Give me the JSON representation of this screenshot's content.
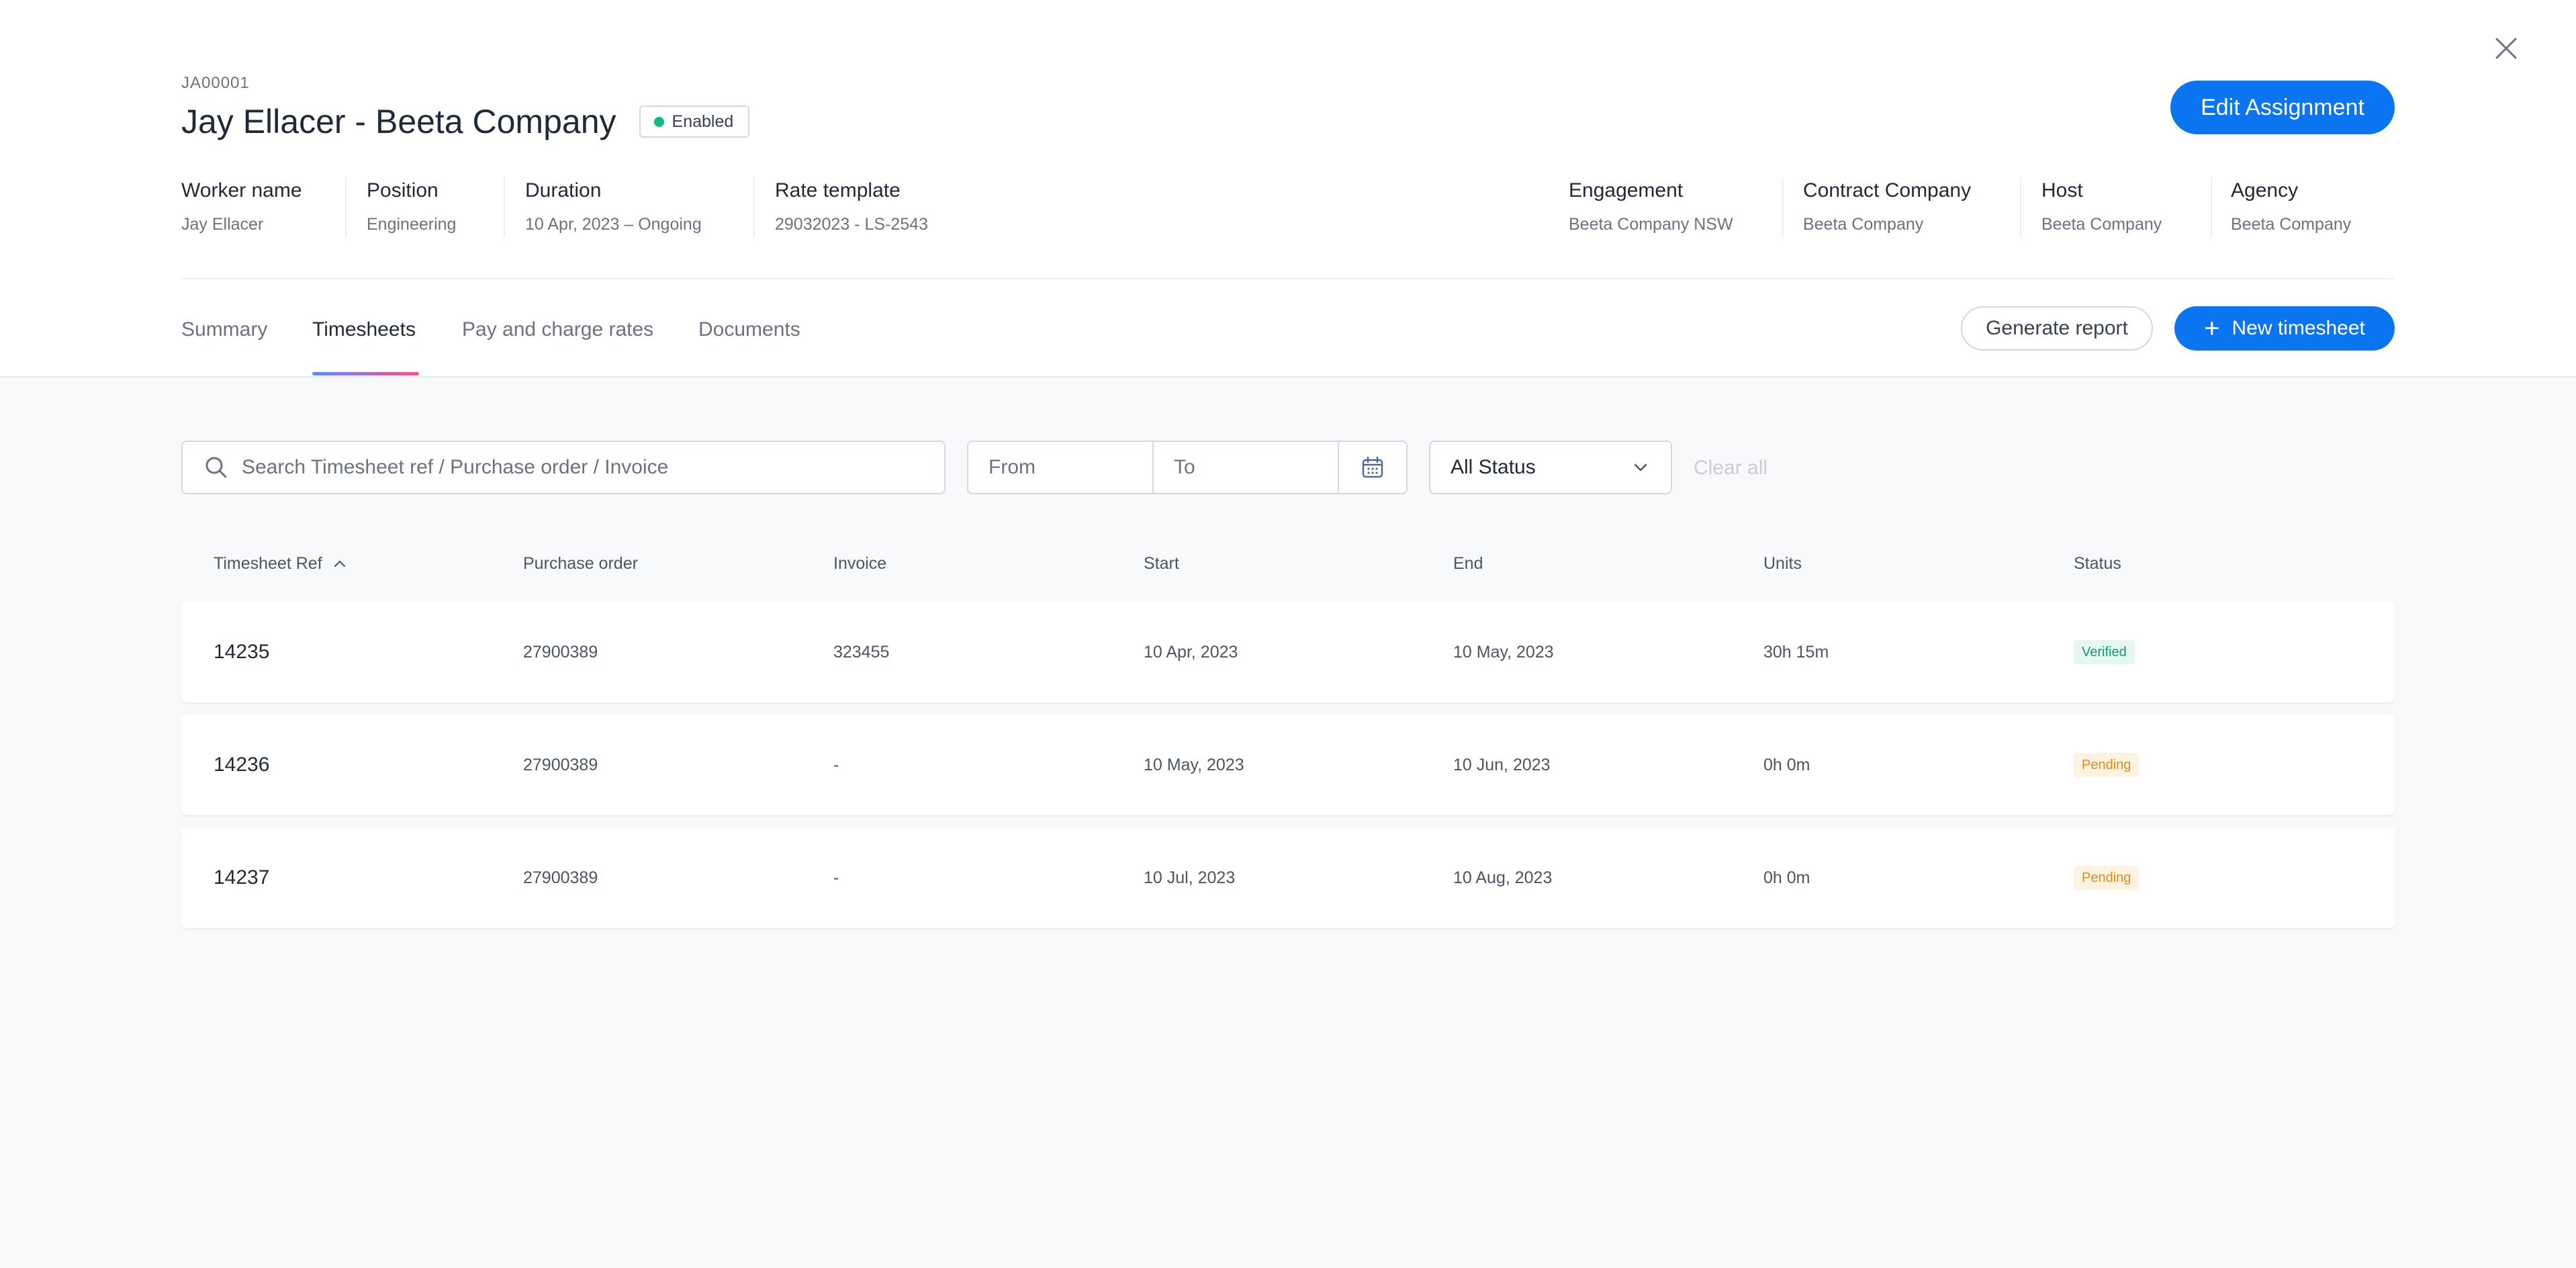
{
  "assignment": {
    "ref_id": "JA00001",
    "title": "Jay Ellacer - Beeta Company",
    "status": "Enabled",
    "status_color": "#10b981",
    "edit_label": "Edit Assignment"
  },
  "meta_left": [
    {
      "label": "Worker name",
      "value": "Jay Ellacer"
    },
    {
      "label": "Position",
      "value": "Engineering"
    },
    {
      "label": "Duration",
      "value": "10 Apr, 2023 – Ongoing"
    },
    {
      "label": "Rate template",
      "value": "29032023 - LS-2543"
    }
  ],
  "meta_right": [
    {
      "label": "Engagement",
      "value": "Beeta Company NSW"
    },
    {
      "label": "Contract Company",
      "value": "Beeta Company"
    },
    {
      "label": "Host",
      "value": "Beeta Company"
    },
    {
      "label": "Agency",
      "value": "Beeta Company"
    }
  ],
  "tabs": [
    {
      "label": "Summary",
      "active": false
    },
    {
      "label": "Timesheets",
      "active": true
    },
    {
      "label": "Pay and charge rates",
      "active": false
    },
    {
      "label": "Documents",
      "active": false
    }
  ],
  "actions": {
    "generate_report": "Generate report",
    "new_timesheet": "New timesheet",
    "new_timesheet_icon": "plus-icon"
  },
  "filters": {
    "search_placeholder": "Search Timesheet ref / Purchase order / Invoice",
    "from_placeholder": "From",
    "to_placeholder": "To",
    "status_value": "All Status",
    "clear_all": "Clear all"
  },
  "table": {
    "columns": [
      "Timesheet Ref",
      "Purchase order",
      "Invoice",
      "Start",
      "End",
      "Units",
      "Status"
    ],
    "rows": [
      {
        "ref": "14235",
        "po": "27900389",
        "invoice": "323455",
        "start": "10 Apr, 2023",
        "end": "10 May, 2023",
        "units": "30h 15m",
        "status": "Verified"
      },
      {
        "ref": "14236",
        "po": "27900389",
        "invoice": "-",
        "start": "10 May, 2023",
        "end": "10 Jun, 2023",
        "units": "0h 0m",
        "status": "Pending"
      },
      {
        "ref": "14237",
        "po": "27900389",
        "invoice": "-",
        "start": "10 Jul, 2023",
        "end": "10 Aug, 2023",
        "units": "0h 0m",
        "status": "Pending"
      }
    ]
  },
  "colors": {
    "accent": "#0b74f0",
    "verified_bg": "#e6f7f1",
    "verified_text": "#0f9a6e",
    "pending_bg": "#fdf3e3",
    "pending_text": "#e08a1a"
  }
}
